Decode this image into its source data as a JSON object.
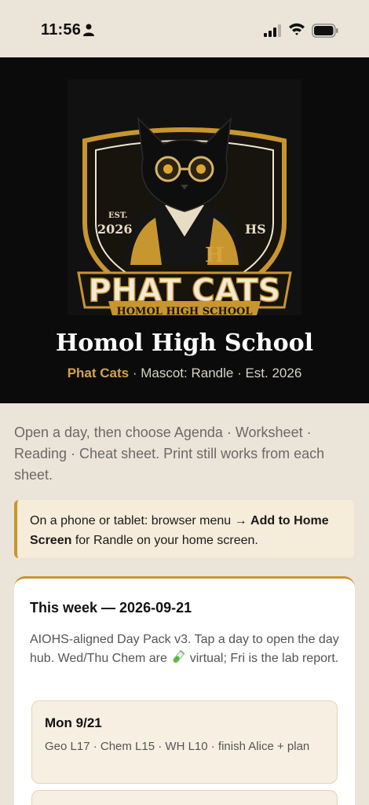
{
  "status_bar": {
    "time": "11:56"
  },
  "hero": {
    "crest": {
      "est_label": "EST.",
      "est_year": "2026",
      "hs_label": "HS",
      "letter": "H",
      "team_name": "PHAT CATS",
      "ribbon_text": "HOMOL HIGH SCHOOL"
    },
    "school_name": "Homol High School",
    "team": "Phat Cats",
    "sub_rest": " · Mascot: Randle · Est. 2026"
  },
  "intro_text": "Open a day, then choose Agenda · Worksheet · Reading · Cheat sheet. Print still works from each sheet.",
  "tip": {
    "prefix": "On a phone or tablet: browser menu → ",
    "bold": "Add to Home Screen",
    "suffix": " for Randle on your home screen."
  },
  "week": {
    "title": "This week — 2026-09-21",
    "desc_before": "AIOHS-aligned Day Pack v3. Tap a day to open the day hub. Wed/Thu Chem are ",
    "desc_after": " virtual; Fri is the lab report.",
    "days": [
      {
        "label": "Mon 9/21",
        "summary": "Geo L17 · Chem L15 · WH L10 · finish Alice + plan"
      },
      {
        "label": "",
        "summary": ""
      }
    ]
  },
  "colors": {
    "accent_gold": "#c8962f",
    "page_bg": "#ebe4d8",
    "hero_bg": "#0b0b0b"
  }
}
